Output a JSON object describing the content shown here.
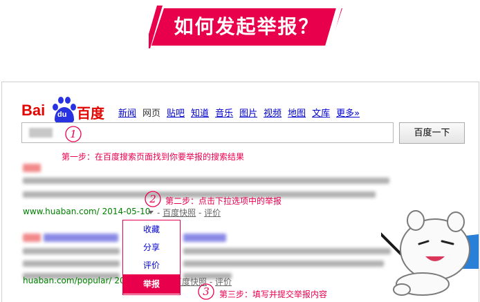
{
  "banner": {
    "title": "如何发起举报？"
  },
  "logo": {
    "bai": "Bai",
    "du": "du",
    "baidu": "百度"
  },
  "nav": {
    "items": [
      {
        "label": "新闻",
        "link": true
      },
      {
        "label": "网页",
        "link": false
      },
      {
        "label": "贴吧",
        "link": true
      },
      {
        "label": "知道",
        "link": true
      },
      {
        "label": "音乐",
        "link": true
      },
      {
        "label": "图片",
        "link": true
      },
      {
        "label": "视频",
        "link": true
      },
      {
        "label": "地图",
        "link": true
      },
      {
        "label": "文库",
        "link": true
      },
      {
        "label": "更多»",
        "link": true
      }
    ]
  },
  "search": {
    "button_label": "百度一下"
  },
  "steps": {
    "step1": {
      "num": "1",
      "text": "第一步：在百度搜索页面找到你要举报的搜索结果"
    },
    "step2": {
      "num": "2",
      "text": "第二步：点击下拉选项中的举报"
    },
    "step3": {
      "num": "3",
      "text": "第三步：填写并提交举报内容"
    }
  },
  "results": [
    {
      "url_prefix": "www.",
      "url_domain": "huaban",
      "url_suffix": ".com/",
      "date": "2014-05-10",
      "snapshot": "百度快照",
      "separator": " - ",
      "rate": "评价"
    },
    {
      "url_prefix": "",
      "url_domain": "huaban",
      "url_suffix": ".com/popular/",
      "date": "201",
      "snapshot": "百度快照",
      "separator": " - ",
      "rate": "评价"
    }
  ],
  "menu": {
    "items": [
      {
        "label": "收藏"
      },
      {
        "label": "分享"
      },
      {
        "label": "评价"
      },
      {
        "label": "举报",
        "active": true
      }
    ]
  },
  "colors": {
    "accent": "#e8004d",
    "baidu_red": "#e10602",
    "baidu_blue": "#2932e1",
    "link": "#0000cc",
    "url_green": "#008000"
  }
}
